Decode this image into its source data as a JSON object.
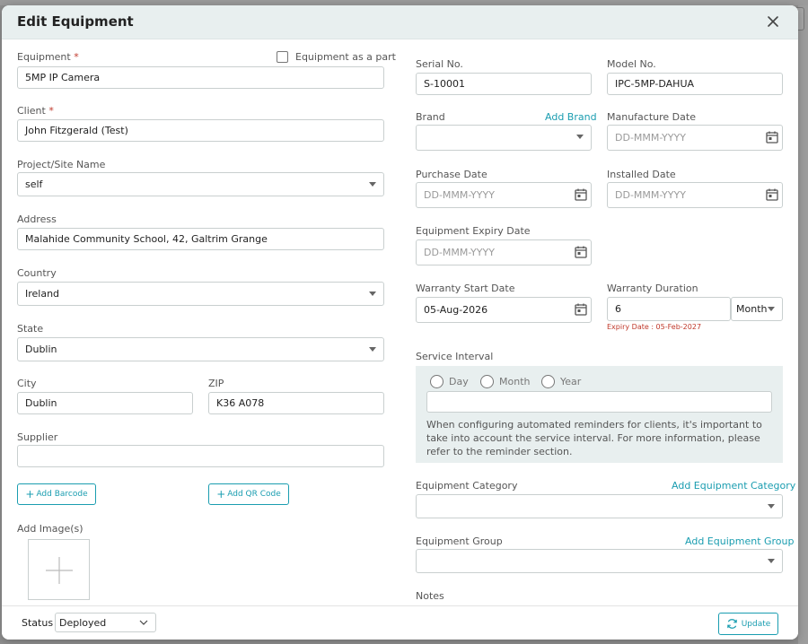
{
  "modal": {
    "title": "Edit Equipment"
  },
  "left": {
    "equipment_label": "Equipment",
    "equipment_value": "5MP IP Camera",
    "equipment_as_part_label": "Equipment as a part",
    "client_label": "Client",
    "client_value": "John Fitzgerald  (Test)",
    "project_label": "Project/Site Name",
    "project_value": "self",
    "address_label": "Address",
    "address_value": "Malahide Community School, 42, Galtrim Grange",
    "country_label": "Country",
    "country_value": "Ireland",
    "state_label": "State",
    "state_value": "Dublin",
    "city_label": "City",
    "city_value": "Dublin",
    "zip_label": "ZIP",
    "zip_value": "K36 A078",
    "supplier_label": "Supplier",
    "supplier_value": "",
    "add_barcode_label": "Add Barcode",
    "add_qr_label": "Add QR Code",
    "add_images_label": "Add Image(s)",
    "required_mark": "*"
  },
  "right": {
    "serial_label": "Serial No.",
    "serial_value": "S-10001",
    "model_label": "Model No.",
    "model_value": "IPC-5MP-DAHUA",
    "brand_label": "Brand",
    "add_brand_label": "Add Brand",
    "brand_value": "",
    "manufacture_label": "Manufacture Date",
    "date_placeholder": "DD-MMM-YYYY",
    "purchase_label": "Purchase Date",
    "installed_label": "Installed Date",
    "expiry_label": "Equipment Expiry Date",
    "warranty_start_label": "Warranty Start Date",
    "warranty_start_value": "05-Aug-2026",
    "warranty_duration_label": "Warranty Duration",
    "warranty_duration_value": "6",
    "warranty_unit": "Month",
    "expiry_date_text": "Expiry Date : 05-Feb-2027",
    "service_interval_label": "Service Interval",
    "service_options": [
      "Day",
      "Month",
      "Year"
    ],
    "service_value": "",
    "service_note": "When configuring automated reminders for clients, it's important to take into account the service interval. For more information, please refer to the reminder section.",
    "category_label": "Equipment Category",
    "add_category_label": "Add Equipment Category",
    "category_value": "",
    "group_label": "Equipment Group",
    "add_group_label": "Add Equipment Group",
    "group_value": "",
    "notes_label": "Notes"
  },
  "footer": {
    "status_label": "Status",
    "status_value": "Deployed",
    "update_label": "Update"
  },
  "colors": {
    "accent": "#1a9db0",
    "required": "#c0392b",
    "header_bg": "#e8efef"
  }
}
